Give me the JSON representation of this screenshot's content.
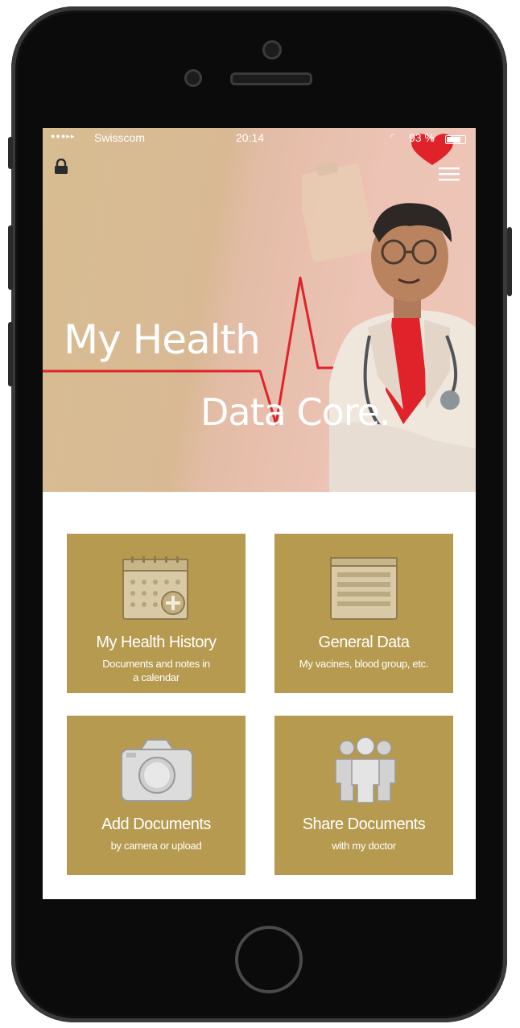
{
  "status_bar": {
    "signal": "●●●▸▸",
    "carrier": "Swisscom",
    "time": "20:14",
    "battery": "93 %"
  },
  "hero": {
    "title_line1": "My Health",
    "title_line2": "Data Core."
  },
  "tiles": [
    {
      "icon": "calendar-add-icon",
      "label": "My Health History",
      "sub_line1": "Documents and notes in",
      "sub_line2": "a calendar"
    },
    {
      "icon": "document-list-icon",
      "label": "General Data",
      "sub_line1": "My vacines, blood group, etc.",
      "sub_line2": ""
    },
    {
      "icon": "camera-icon",
      "label": "Add Documents",
      "sub_line1": "by camera or upload",
      "sub_line2": ""
    },
    {
      "icon": "people-group-icon",
      "label": "Share Documents",
      "sub_line1": "with my doctor",
      "sub_line2": ""
    }
  ],
  "colors": {
    "tile": "#b69a4f",
    "accent_red": "#e0232b",
    "hero_gold": "#d7bd92",
    "hero_pink": "#eec6b8"
  }
}
